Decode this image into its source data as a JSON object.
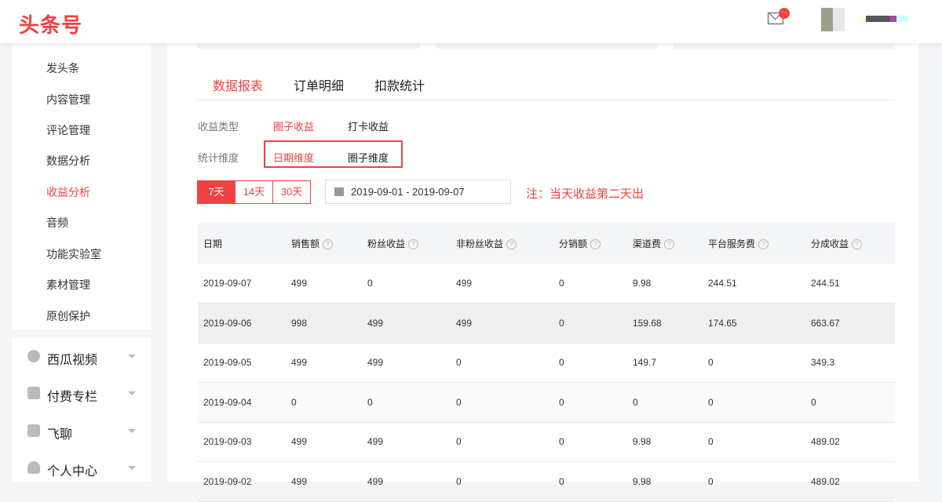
{
  "header": {
    "logo": "头条号",
    "badge": "···"
  },
  "sidebar": {
    "items": [
      "发头条",
      "内容管理",
      "评论管理",
      "数据分析",
      "收益分析",
      "音频",
      "功能实验室",
      "素材管理",
      "原创保护"
    ],
    "active": 4,
    "groups": [
      "西瓜视频",
      "付费专栏",
      "飞聊",
      "个人中心"
    ]
  },
  "tabs": [
    "数据报表",
    "订单明细",
    "扣款统计"
  ],
  "filters": {
    "type_label": "收益类型",
    "type_options": [
      "圈子收益",
      "打卡收益"
    ],
    "dim_label": "统计维度",
    "dim_options": [
      "日期维度",
      "圈子维度"
    ]
  },
  "range_buttons": [
    "7天",
    "14天",
    "30天"
  ],
  "date_range": "2019-09-01 - 2019-09-07",
  "note": "注：当天收益第二天出",
  "table": {
    "headers": [
      "日期",
      "销售额",
      "粉丝收益",
      "非粉丝收益",
      "分销额",
      "渠道费",
      "平台服务费",
      "分成收益"
    ],
    "rows": [
      [
        "2019-09-07",
        "499",
        "0",
        "499",
        "0",
        "9.98",
        "244.51",
        "244.51"
      ],
      [
        "2019-09-06",
        "998",
        "499",
        "499",
        "0",
        "159.68",
        "174.65",
        "663.67"
      ],
      [
        "2019-09-05",
        "499",
        "499",
        "0",
        "0",
        "149.7",
        "0",
        "349.3"
      ],
      [
        "2019-09-04",
        "0",
        "0",
        "0",
        "0",
        "0",
        "0",
        "0"
      ],
      [
        "2019-09-03",
        "499",
        "499",
        "0",
        "0",
        "9.98",
        "0",
        "489.02"
      ],
      [
        "2019-09-02",
        "499",
        "499",
        "0",
        "0",
        "9.98",
        "0",
        "489.02"
      ]
    ]
  }
}
